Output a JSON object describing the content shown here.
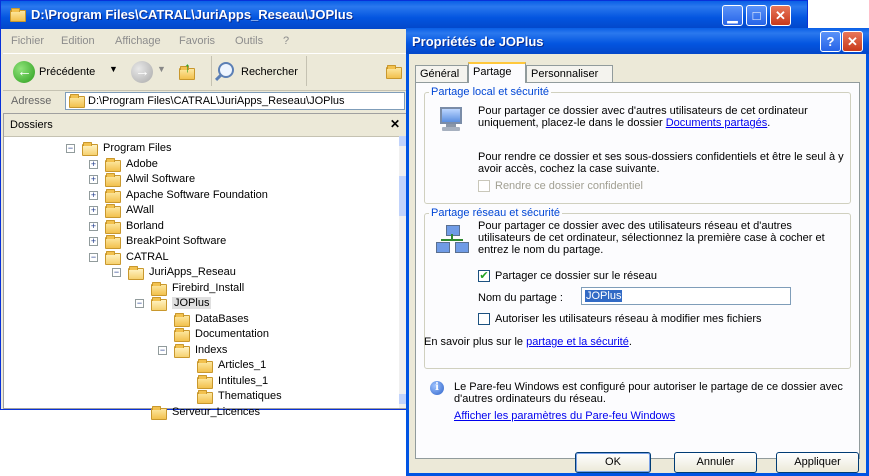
{
  "explorer": {
    "title": "D:\\Program Files\\CATRAL\\JuriApps_Reseau\\JOPlus",
    "menu": [
      "Fichier",
      "Edition",
      "Affichage",
      "Favoris",
      "Outils",
      "?"
    ],
    "toolbar": {
      "back_label": "Précédente",
      "search_label": "Rechercher"
    },
    "address": {
      "label": "Adresse",
      "value": "D:\\Program Files\\CATRAL\\JuriApps_Reseau\\JOPlus"
    },
    "folders": {
      "title": "Dossiers",
      "tree": [
        {
          "label": "Program Files",
          "expander": "−",
          "level": 0,
          "open": true
        },
        {
          "label": "Adobe",
          "expander": "+",
          "level": 1
        },
        {
          "label": "Alwil Software",
          "expander": "+",
          "level": 1
        },
        {
          "label": "Apache Software Foundation",
          "expander": "+",
          "level": 1
        },
        {
          "label": "AWall",
          "expander": "+",
          "level": 1
        },
        {
          "label": "Borland",
          "expander": "+",
          "level": 1
        },
        {
          "label": "BreakPoint Software",
          "expander": "+",
          "level": 1
        },
        {
          "label": "CATRAL",
          "expander": "−",
          "level": 1,
          "open": true
        },
        {
          "label": "JuriApps_Reseau",
          "expander": "−",
          "level": 2,
          "open": true
        },
        {
          "label": "Firebird_Install",
          "expander": "",
          "level": 3
        },
        {
          "label": "JOPlus",
          "expander": "−",
          "level": 3,
          "open": true,
          "selected": true
        },
        {
          "label": "DataBases",
          "expander": "",
          "level": 4
        },
        {
          "label": "Documentation",
          "expander": "",
          "level": 4
        },
        {
          "label": "Indexs",
          "expander": "−",
          "level": 4,
          "open": true
        },
        {
          "label": "Articles_1",
          "expander": "",
          "level": 5
        },
        {
          "label": "Intitules_1",
          "expander": "",
          "level": 5
        },
        {
          "label": "Thematiques",
          "expander": "",
          "level": 5
        },
        {
          "label": "Serveur_Licences",
          "expander": "",
          "level": 3
        }
      ]
    }
  },
  "dialog": {
    "title": "Propriétés de JOPlus",
    "help_label": "?",
    "close_label": "✕",
    "tabs": [
      "Général",
      "Partage",
      "Personnaliser"
    ],
    "active_tab": "Partage",
    "local": {
      "title": "Partage local et sécurité",
      "text1": "Pour partager ce dossier avec d'autres utilisateurs de cet ordinateur uniquement, placez-le dans le dossier",
      "link": "Documents partagés",
      "link_suffix": ".",
      "text2": "Pour rendre ce dossier et ses sous-dossiers confidentiels et être le seul à y avoir accès, cochez la case suivante.",
      "private_checkbox": "Rendre ce dossier confidentiel"
    },
    "network": {
      "title": "Partage réseau et sécurité",
      "text": "Pour partager ce dossier avec des utilisateurs réseau et d'autres utilisateurs de cet ordinateur, sélectionnez la première case à cocher et entrez le nom du partage.",
      "share_checkbox": "Partager ce dossier sur le réseau",
      "share_checked": true,
      "share_name_label": "Nom du partage :",
      "share_name_value": "JOPlus",
      "allow_modify_checkbox": "Autoriser les utilisateurs réseau à modifier mes fichiers",
      "allow_modify_checked": false,
      "learn_more_prefix": "En savoir plus sur le",
      "learn_more_link": "partage et la sécurité",
      "learn_more_suffix": "."
    },
    "firewall": {
      "text": "Le Pare-feu Windows est configuré pour autoriser le partage de ce dossier avec d'autres ordinateurs du réseau.",
      "link": "Afficher les paramètres du Pare-feu Windows"
    },
    "buttons": {
      "ok": "OK",
      "cancel": "Annuler",
      "apply": "Appliquer"
    }
  },
  "colors": {
    "title_blue": "#0355e0",
    "group_title": "#0046d5",
    "close_red": "#e24a2a",
    "dialog_bg": "#ece9d8"
  }
}
